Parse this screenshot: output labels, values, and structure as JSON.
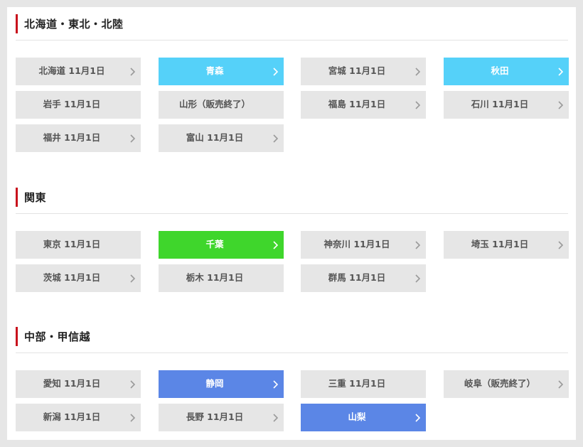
{
  "sections": [
    {
      "title": "北海道・東北・北陸",
      "items": [
        {
          "label": "北海道 11月1日",
          "chevron": true
        },
        {
          "label": "青森",
          "chevron": true,
          "color": "#55d1f9"
        },
        {
          "label": "宮城 11月1日",
          "chevron": true
        },
        {
          "label": "秋田",
          "chevron": true,
          "color": "#55d1f9"
        },
        {
          "label": "岩手 11月1日",
          "chevron": false
        },
        {
          "label": "山形（販売終了）",
          "chevron": false
        },
        {
          "label": "福島 11月1日",
          "chevron": true
        },
        {
          "label": "石川 11月1日",
          "chevron": true
        },
        {
          "label": "福井 11月1日",
          "chevron": true
        },
        {
          "label": "富山 11月1日",
          "chevron": true
        }
      ]
    },
    {
      "title": "関東",
      "items": [
        {
          "label": "東京 11月1日",
          "chevron": false
        },
        {
          "label": "千葉",
          "chevron": true,
          "color": "#3fd62c"
        },
        {
          "label": "神奈川 11月1日",
          "chevron": true
        },
        {
          "label": "埼玉 11月1日",
          "chevron": true
        },
        {
          "label": "茨城 11月1日",
          "chevron": true
        },
        {
          "label": "栃木 11月1日",
          "chevron": false
        },
        {
          "label": "群馬 11月1日",
          "chevron": true
        }
      ]
    },
    {
      "title": "中部・甲信越",
      "items": [
        {
          "label": "愛知 11月1日",
          "chevron": true
        },
        {
          "label": "静岡",
          "chevron": true,
          "color": "#5b86e6"
        },
        {
          "label": "三重 11月1日",
          "chevron": false
        },
        {
          "label": "岐阜（販売終了）",
          "chevron": true
        },
        {
          "label": "新潟 11月1日",
          "chevron": true
        },
        {
          "label": "長野 11月1日",
          "chevron": true
        },
        {
          "label": "山梨",
          "chevron": true,
          "color": "#5b86e6"
        }
      ]
    }
  ],
  "icons": {
    "chevron": "chevron-right-icon"
  },
  "colors": {
    "accent_bar": "#c8101c",
    "button_bg": "#e6e6e6",
    "label_text": "#555555"
  }
}
